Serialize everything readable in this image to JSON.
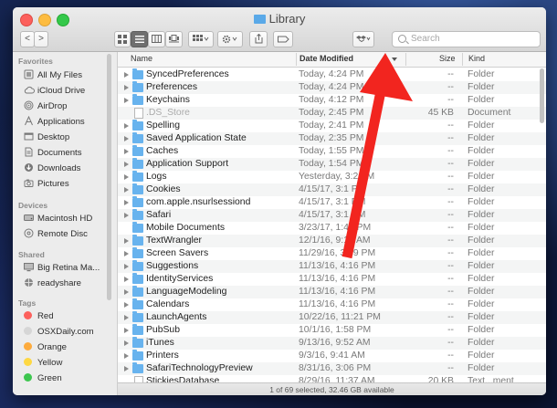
{
  "window": {
    "title": "Library",
    "nav_back": "<",
    "nav_forward": ">",
    "search_placeholder": "Search"
  },
  "sidebar": {
    "favorites_header": "Favorites",
    "favorites": [
      {
        "label": "All My Files",
        "icon": "all-files-icon"
      },
      {
        "label": "iCloud Drive",
        "icon": "cloud-icon"
      },
      {
        "label": "AirDrop",
        "icon": "airdrop-icon"
      },
      {
        "label": "Applications",
        "icon": "applications-icon"
      },
      {
        "label": "Desktop",
        "icon": "desktop-icon"
      },
      {
        "label": "Documents",
        "icon": "documents-icon"
      },
      {
        "label": "Downloads",
        "icon": "downloads-icon"
      },
      {
        "label": "Pictures",
        "icon": "pictures-icon"
      }
    ],
    "devices_header": "Devices",
    "devices": [
      {
        "label": "Macintosh HD",
        "icon": "harddisk-icon"
      },
      {
        "label": "Remote Disc",
        "icon": "disc-icon"
      }
    ],
    "shared_header": "Shared",
    "shared": [
      {
        "label": "Big Retina Ma...",
        "icon": "display-icon"
      },
      {
        "label": "readyshare",
        "icon": "network-icon"
      }
    ],
    "tags_header": "Tags",
    "tags": [
      {
        "label": "Red",
        "color": "#fc615d"
      },
      {
        "label": "OSXDaily.com",
        "color": "#d6d6d6"
      },
      {
        "label": "Orange",
        "color": "#fdab3d"
      },
      {
        "label": "Yellow",
        "color": "#fed843"
      },
      {
        "label": "Green",
        "color": "#3dc64f"
      }
    ]
  },
  "columns": {
    "name": "Name",
    "date": "Date Modified",
    "size": "Size",
    "kind": "Kind"
  },
  "files": [
    {
      "name": "SyncedPreferences",
      "date": "Today, 4:24 PM",
      "size": "-- ",
      "kind": "Folder",
      "type": "folder"
    },
    {
      "name": "Preferences",
      "date": "Today, 4:24 PM",
      "size": "-- ",
      "kind": "Folder",
      "type": "folder"
    },
    {
      "name": "Keychains",
      "date": "Today, 4:12 PM",
      "size": "-- ",
      "kind": "Folder",
      "type": "folder"
    },
    {
      "name": ".DS_Store",
      "date": "Today, 2:45 PM",
      "size": "45 KB",
      "kind": "Document",
      "type": "doc"
    },
    {
      "name": "Spelling",
      "date": "Today, 2:41 PM",
      "size": "-- ",
      "kind": "Folder",
      "type": "folder"
    },
    {
      "name": "Saved Application State",
      "date": "Today, 2:35 PM",
      "size": "-- ",
      "kind": "Folder",
      "type": "folder"
    },
    {
      "name": "Caches",
      "date": "Today, 1:55 PM",
      "size": "-- ",
      "kind": "Folder",
      "type": "folder"
    },
    {
      "name": "Application Support",
      "date": "Today, 1:54 PM",
      "size": "-- ",
      "kind": "Folder",
      "type": "folder"
    },
    {
      "name": "Logs",
      "date": "Yesterday, 3:2 AM",
      "size": "-- ",
      "kind": "Folder",
      "type": "folder"
    },
    {
      "name": "Cookies",
      "date": "4/15/17, 3:1 PM",
      "size": "-- ",
      "kind": "Folder",
      "type": "folder"
    },
    {
      "name": "com.apple.nsurlsessiond",
      "date": "4/15/17, 3:1 PM",
      "size": "-- ",
      "kind": "Folder",
      "type": "folder"
    },
    {
      "name": "Safari",
      "date": "4/15/17, 3:1 PM",
      "size": "-- ",
      "kind": "Folder",
      "type": "folder"
    },
    {
      "name": "Mobile Documents",
      "date": "3/23/17, 1:46 PM",
      "size": "-- ",
      "kind": "Folder",
      "type": "folder-nodisc"
    },
    {
      "name": "TextWrangler",
      "date": "12/1/16, 9:10 AM",
      "size": "-- ",
      "kind": "Folder",
      "type": "folder"
    },
    {
      "name": "Screen Savers",
      "date": "11/29/16, 3:59 PM",
      "size": "-- ",
      "kind": "Folder",
      "type": "folder"
    },
    {
      "name": "Suggestions",
      "date": "11/13/16, 4:16 PM",
      "size": "-- ",
      "kind": "Folder",
      "type": "folder"
    },
    {
      "name": "IdentityServices",
      "date": "11/13/16, 4:16 PM",
      "size": "-- ",
      "kind": "Folder",
      "type": "folder"
    },
    {
      "name": "LanguageModeling",
      "date": "11/13/16, 4:16 PM",
      "size": "-- ",
      "kind": "Folder",
      "type": "folder"
    },
    {
      "name": "Calendars",
      "date": "11/13/16, 4:16 PM",
      "size": "-- ",
      "kind": "Folder",
      "type": "folder"
    },
    {
      "name": "LaunchAgents",
      "date": "10/22/16, 11:21 PM",
      "size": "-- ",
      "kind": "Folder",
      "type": "folder"
    },
    {
      "name": "PubSub",
      "date": "10/1/16, 1:58 PM",
      "size": "-- ",
      "kind": "Folder",
      "type": "folder"
    },
    {
      "name": "iTunes",
      "date": "9/13/16, 9:52 AM",
      "size": "-- ",
      "kind": "Folder",
      "type": "folder"
    },
    {
      "name": "Printers",
      "date": "9/3/16, 9:41 AM",
      "size": "-- ",
      "kind": "Folder",
      "type": "folder"
    },
    {
      "name": "SafariTechnologyPreview",
      "date": "8/31/16, 3:06 PM",
      "size": "-- ",
      "kind": "Folder",
      "type": "folder"
    },
    {
      "name": "StickiesDatabase",
      "date": "8/29/16, 11:37 AM",
      "size": "20 KB",
      "kind": "Text...ment",
      "type": "doc"
    }
  ],
  "status": "1 of 69 selected, 32.46 GB available",
  "colors": {
    "arrow": "#f2251f",
    "folder": "#68b3ee"
  }
}
